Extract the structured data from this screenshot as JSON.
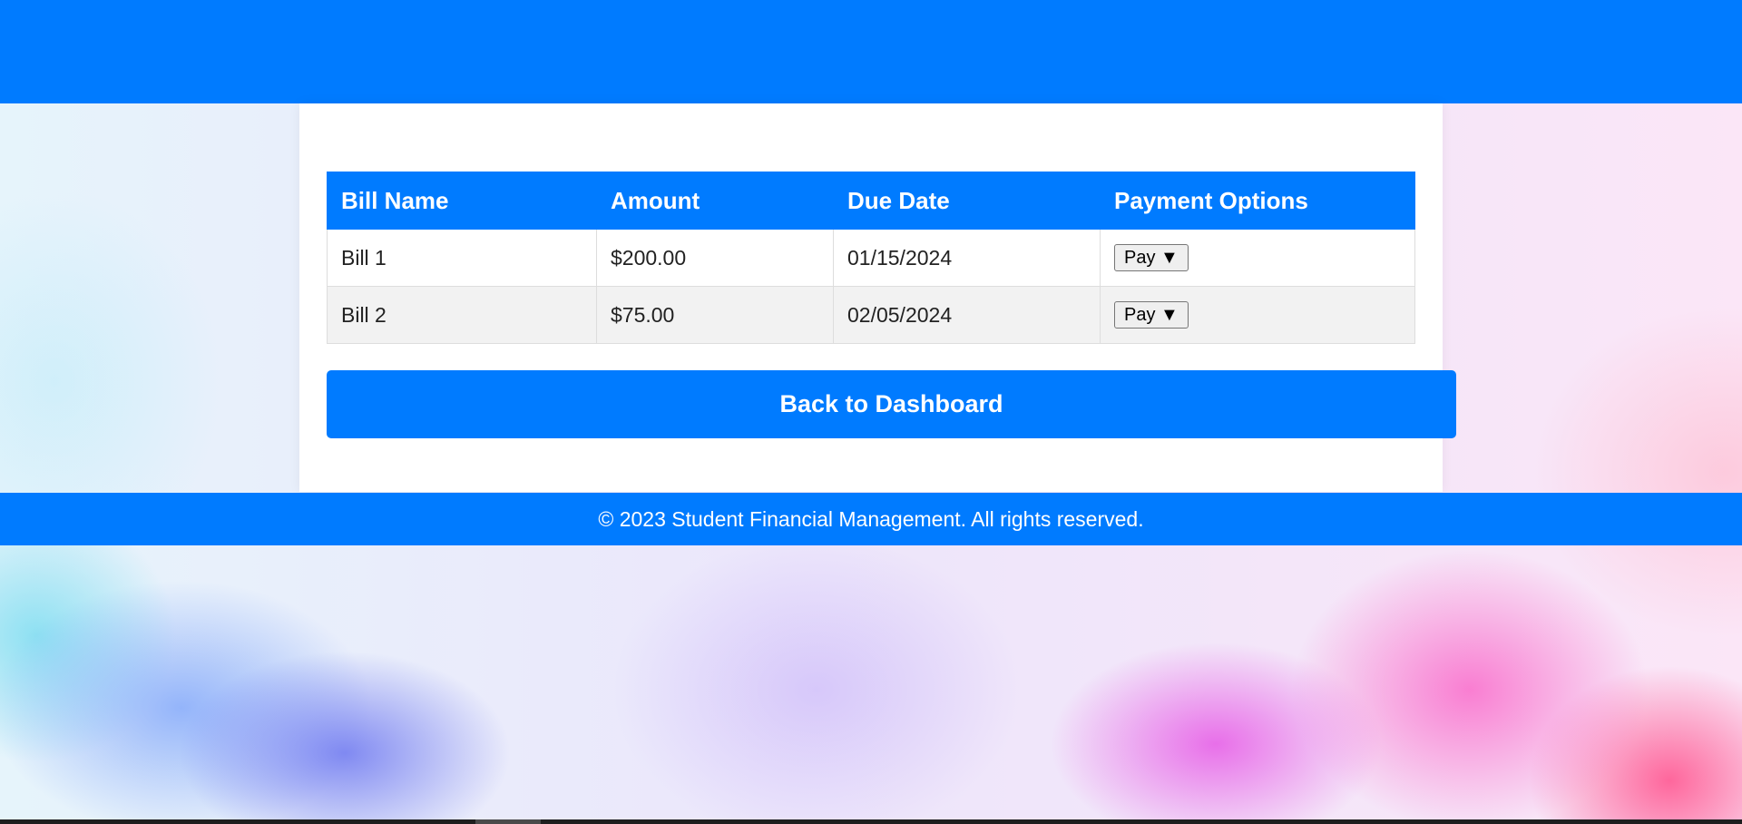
{
  "table": {
    "headers": [
      "Bill Name",
      "Amount",
      "Due Date",
      "Payment Options"
    ],
    "rows": [
      {
        "name": "Bill 1",
        "amount": "$200.00",
        "due_date": "01/15/2024",
        "action_label": "Pay ▼"
      },
      {
        "name": "Bill 2",
        "amount": "$75.00",
        "due_date": "02/05/2024",
        "action_label": "Pay ▼"
      }
    ]
  },
  "actions": {
    "back_label": "Back to Dashboard"
  },
  "footer": {
    "text": "© 2023 Student Financial Management. All rights reserved."
  },
  "colors": {
    "primary": "#007bff",
    "row_alt": "#f2f2f2"
  }
}
